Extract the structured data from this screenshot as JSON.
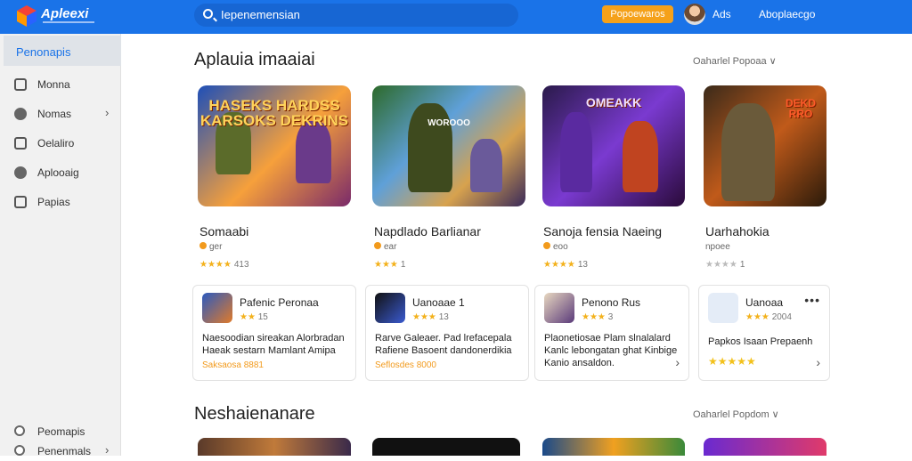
{
  "header": {
    "brand": "Apleexi",
    "search_text": "Iepenemensian",
    "orange_button": "Popoewaros",
    "user_name": "Ads",
    "apps_link": "Aboplaecgo"
  },
  "sidebar": {
    "active": "Penonapis",
    "items": [
      {
        "label": "Monna",
        "icon": "home-icon"
      },
      {
        "label": "Nomas",
        "icon": "discover-icon",
        "chevron": true
      },
      {
        "label": "Oelaliro",
        "icon": "list-icon"
      },
      {
        "label": "Aplooaig",
        "icon": "chat-icon"
      },
      {
        "label": "Papias",
        "icon": "profile-icon"
      }
    ],
    "bottom_items": [
      {
        "label": "Peomapis",
        "icon": "settings-icon"
      },
      {
        "label": "Penenmals",
        "icon": "link-icon",
        "chevron": true
      }
    ]
  },
  "section1": {
    "title": "Aplauia imaaiai",
    "filter": "Oaharlel Popoaa",
    "cards": [
      {
        "title": "Somaabi",
        "meta": "ger",
        "stars": "★★★★",
        "rating": "413",
        "art_text": "HASEKS HARDSS KARSOKS DEKRINS"
      },
      {
        "title": "Napdlado Barlianar",
        "meta": "ear",
        "stars": "★★★",
        "rating": "1",
        "art_text": "WOROOO"
      },
      {
        "title": "Sanoja fensia Naeing",
        "meta": "eoo",
        "stars": "★★★★",
        "rating": "13",
        "art_text": "OMEAKK"
      },
      {
        "title": "Uarhahokia",
        "meta": "npoee",
        "stars": "★★★★",
        "rating": "1",
        "art_text": "DEKD RRO"
      }
    ],
    "tiles": [
      {
        "name": "Pafenic Peronaa",
        "stars": "★★",
        "rating": "15",
        "desc": "Naesoodian sireakan Alorbradan Haeak sestarn Mamlant Amipa",
        "price": "Saksaosa 8881"
      },
      {
        "name": "Uanoaae 1",
        "stars": "★★★",
        "rating": "13",
        "desc": "Rarve Galeaer. Pad lrefacepala Rafiene Basoent dandonerdikia",
        "price": "Seflosdes 8000"
      },
      {
        "name": "Penono Rus",
        "stars": "★★★",
        "rating": "3",
        "desc": "Plaonetiosae Plam slnalalard Kanlc lebongatan ghat Kinbige Kanio ansaldon.",
        "price": ""
      },
      {
        "name": "Uanoaa",
        "stars": "★★★",
        "rating": "2004",
        "desc": "Papkos Isaan Prepaenh",
        "price": "★★★★★"
      }
    ]
  },
  "section2": {
    "title": "Neshaienanare",
    "filter": "Oaharlel Popdom"
  }
}
